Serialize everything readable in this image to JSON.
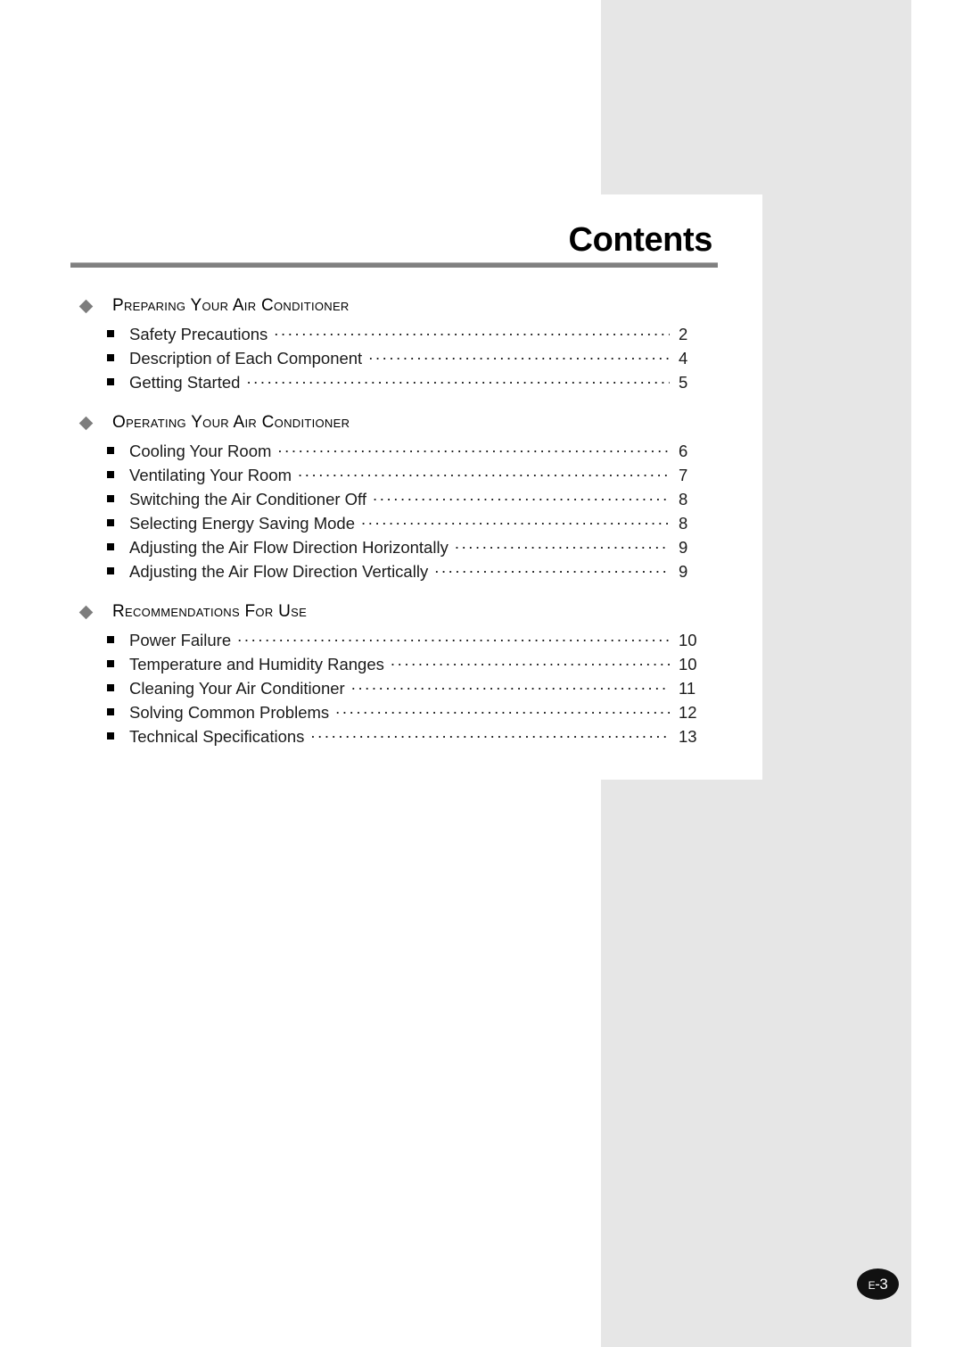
{
  "document": {
    "title": "Contents",
    "page_label": "E-3",
    "page_label_prefix": "E",
    "page_label_number": "-3"
  },
  "icons": {
    "section_bullet": "diamond-bullet-icon",
    "entry_bullet": "square-bullet-icon"
  },
  "colors": {
    "panel_gray": "#e6e6e6",
    "rule_gray": "#808080",
    "diamond_gray": "#7d7d7d",
    "text_black": "#1a1a1a",
    "badge_black": "#111111"
  },
  "toc": {
    "sections": [
      {
        "title": "Preparing Your Air Conditioner",
        "entries": [
          {
            "label": "Safety Precautions",
            "page": "2"
          },
          {
            "label": "Description of Each Component",
            "page": "4"
          },
          {
            "label": "Getting Started",
            "page": "5"
          }
        ]
      },
      {
        "title": "Operating Your Air Conditioner",
        "entries": [
          {
            "label": "Cooling Your Room",
            "page": "6"
          },
          {
            "label": "Ventilating Your Room",
            "page": "7"
          },
          {
            "label": "Switching the Air Conditioner Off",
            "page": "8"
          },
          {
            "label": "Selecting Energy Saving Mode",
            "page": "8"
          },
          {
            "label": "Adjusting the Air Flow Direction Horizontally",
            "page": "9"
          },
          {
            "label": "Adjusting the Air Flow Direction Vertically",
            "page": "9"
          }
        ]
      },
      {
        "title": "Recommendations For Use",
        "entries": [
          {
            "label": "Power Failure",
            "page": "10"
          },
          {
            "label": "Temperature and Humidity Ranges",
            "page": "10"
          },
          {
            "label": "Cleaning Your Air Conditioner",
            "page": "11"
          },
          {
            "label": "Solving Common Problems",
            "page": "12"
          },
          {
            "label": "Technical Specifications",
            "page": "13"
          }
        ]
      }
    ]
  }
}
